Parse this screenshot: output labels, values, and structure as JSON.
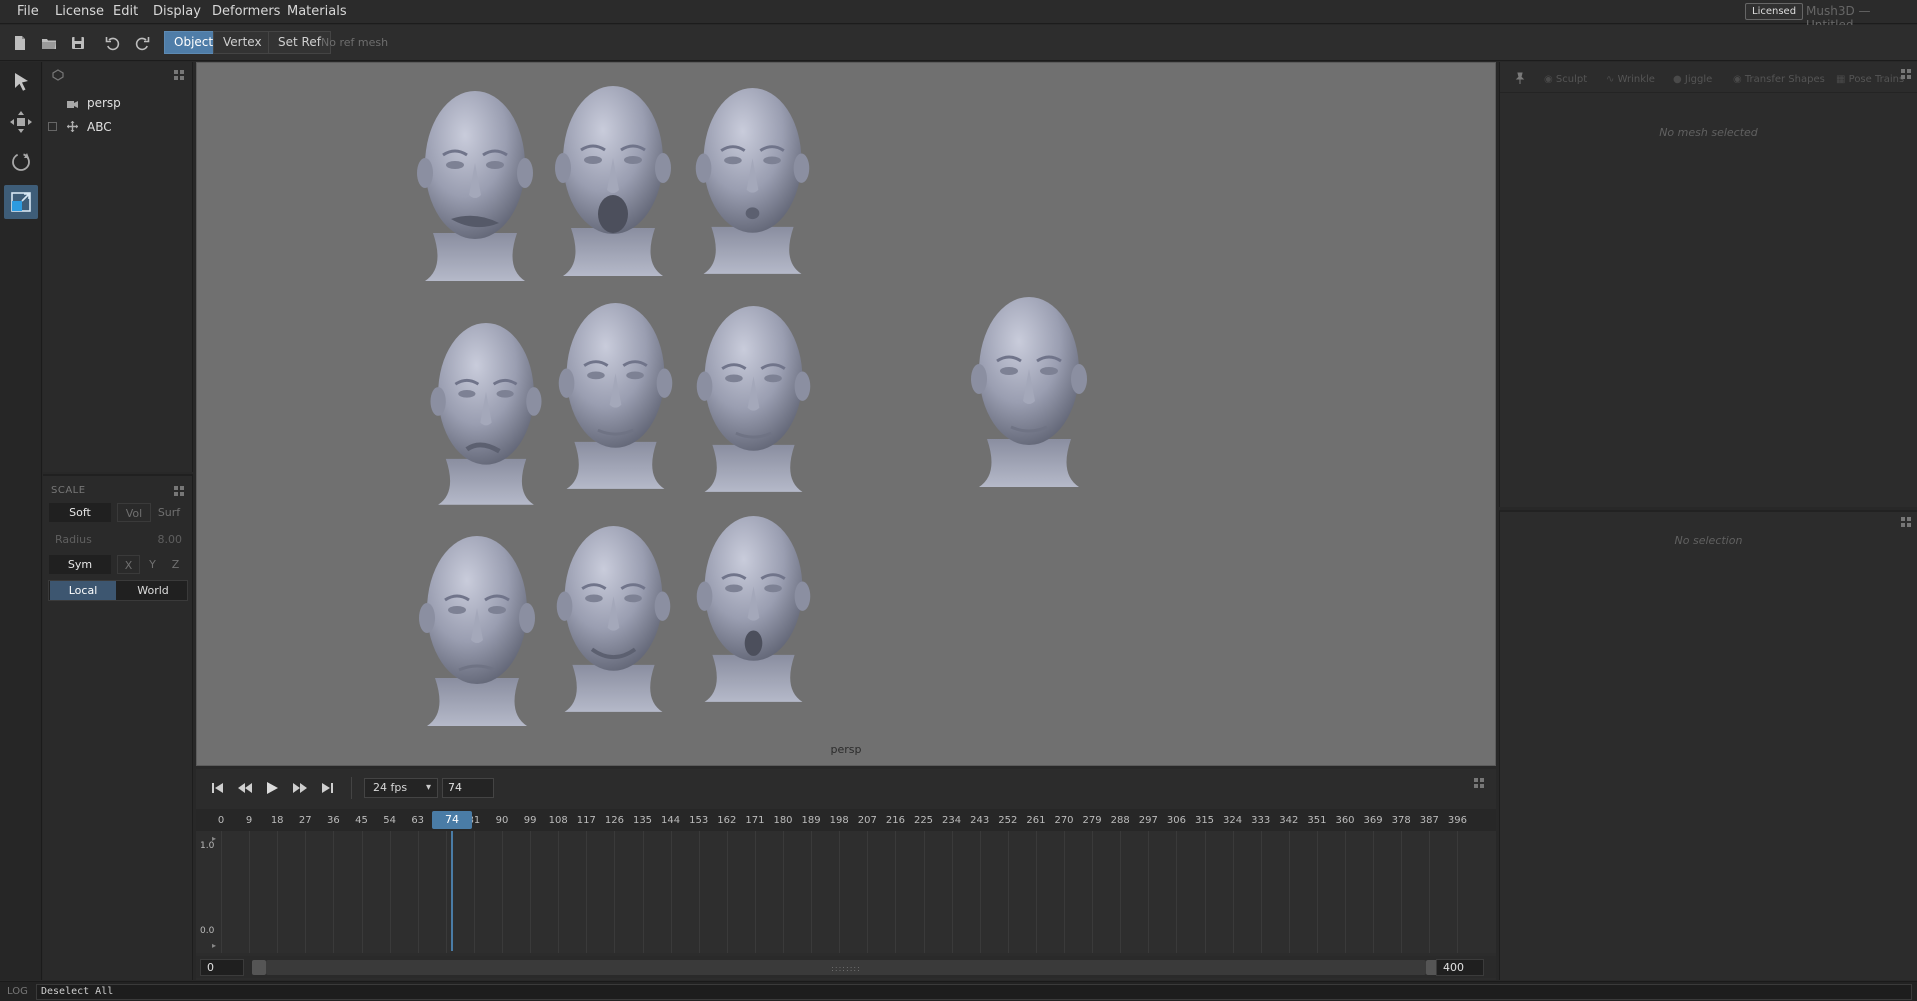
{
  "app": {
    "title": "Mush3D — Untitled",
    "license_badge": "Licensed"
  },
  "menu": [
    "File",
    "License",
    "Edit",
    "Display",
    "Deformers",
    "Materials"
  ],
  "toolbar": {
    "icons": [
      "new-file-icon",
      "open-folder-icon",
      "save-icon",
      "undo-icon",
      "redo-icon"
    ],
    "mode_object": "Object",
    "mode_vertex": "Vertex",
    "active_mode": "Object",
    "set_ref": "Set Ref",
    "ref_status": "No ref mesh"
  },
  "tools": [
    "select-arrow-icon",
    "move-icon",
    "rotate-icon",
    "scale-icon"
  ],
  "active_tool": "scale-icon",
  "outliner": {
    "items": [
      {
        "label": "persp",
        "icon": "camera-icon"
      },
      {
        "label": "ABC",
        "icon": "transform-icon"
      }
    ]
  },
  "scale_panel": {
    "title": "SCALE",
    "soft": "Soft",
    "vol": "Vol",
    "surf": "Surf",
    "radius_label": "Radius",
    "radius_value": "8.00",
    "sym": "Sym",
    "x": "X",
    "y": "Y",
    "z": "Z",
    "local": "Local",
    "world": "World",
    "active_space": "Local"
  },
  "viewport": {
    "camera_label": "persp"
  },
  "timeline": {
    "fps": "24 fps",
    "current_frame": "74",
    "ticks": [
      "0",
      "9",
      "18",
      "27",
      "36",
      "45",
      "54",
      "63",
      "72",
      "81",
      "90",
      "99",
      "108",
      "117",
      "126",
      "135",
      "144",
      "153",
      "162",
      "171",
      "180",
      "189",
      "198",
      "207",
      "216",
      "225",
      "234",
      "243",
      "252",
      "261",
      "270",
      "279",
      "288",
      "297",
      "306",
      "315",
      "324",
      "333",
      "342",
      "351",
      "360",
      "369",
      "378",
      "387",
      "396"
    ],
    "y_max": "1.0",
    "y_min": "0.0",
    "range_start": "0",
    "range_end": "400"
  },
  "right_panel": {
    "tabs": [
      "Sculpt",
      "Wrinkle",
      "Jiggle",
      "Transfer Shapes",
      "Pose Trains"
    ],
    "empty_top": "No mesh selected",
    "empty_bottom": "No selection"
  },
  "log": {
    "tag": "LOG",
    "message": "Deselect All"
  }
}
